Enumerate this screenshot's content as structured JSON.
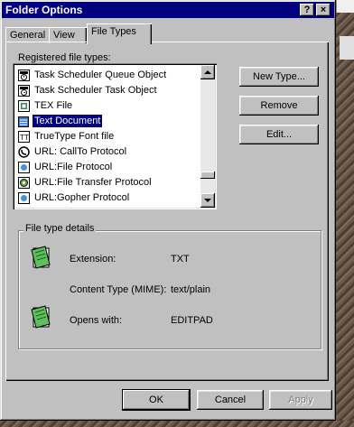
{
  "dialog": {
    "title": "Folder Options",
    "help_glyph": "?",
    "close_glyph": "×"
  },
  "tabs": [
    {
      "label": "General",
      "active": false
    },
    {
      "label": "View",
      "active": false
    },
    {
      "label": "File Types",
      "active": true
    }
  ],
  "registered": {
    "label": "Registered file types:",
    "items": [
      {
        "label": "Task Scheduler Queue Object",
        "icon": "task-scheduler-icon",
        "selected": false
      },
      {
        "label": "Task Scheduler Task Object",
        "icon": "task-scheduler-icon",
        "selected": false
      },
      {
        "label": "TEX File",
        "icon": "tex-file-icon",
        "selected": false
      },
      {
        "label": "Text Document",
        "icon": "notepad-icon",
        "selected": true
      },
      {
        "label": "TrueType Font file",
        "icon": "font-file-icon",
        "selected": false
      },
      {
        "label": "URL: CallTo Protocol",
        "icon": "callto-protocol-icon",
        "selected": false
      },
      {
        "label": "URL:File Protocol",
        "icon": "url-protocol-icon",
        "selected": false
      },
      {
        "label": "URL:File Transfer Protocol",
        "icon": "ftp-protocol-icon",
        "selected": false
      },
      {
        "label": "URL:Gopher Protocol",
        "icon": "url-protocol-icon",
        "selected": false
      }
    ]
  },
  "side_buttons": {
    "new_type": "New Type...",
    "remove": "Remove",
    "edit": "Edit..."
  },
  "details": {
    "title": "File type details",
    "extension_label": "Extension:",
    "extension_value": "TXT",
    "mime_label": "Content Type (MIME):",
    "mime_value": "text/plain",
    "opens_label": "Opens with:",
    "opens_value": "EDITPAD"
  },
  "footer": {
    "ok": "OK",
    "cancel": "Cancel",
    "apply": "Apply"
  },
  "colors": {
    "title_bar": "#000080",
    "face": "#c0c0c0",
    "selection": "#000080"
  }
}
